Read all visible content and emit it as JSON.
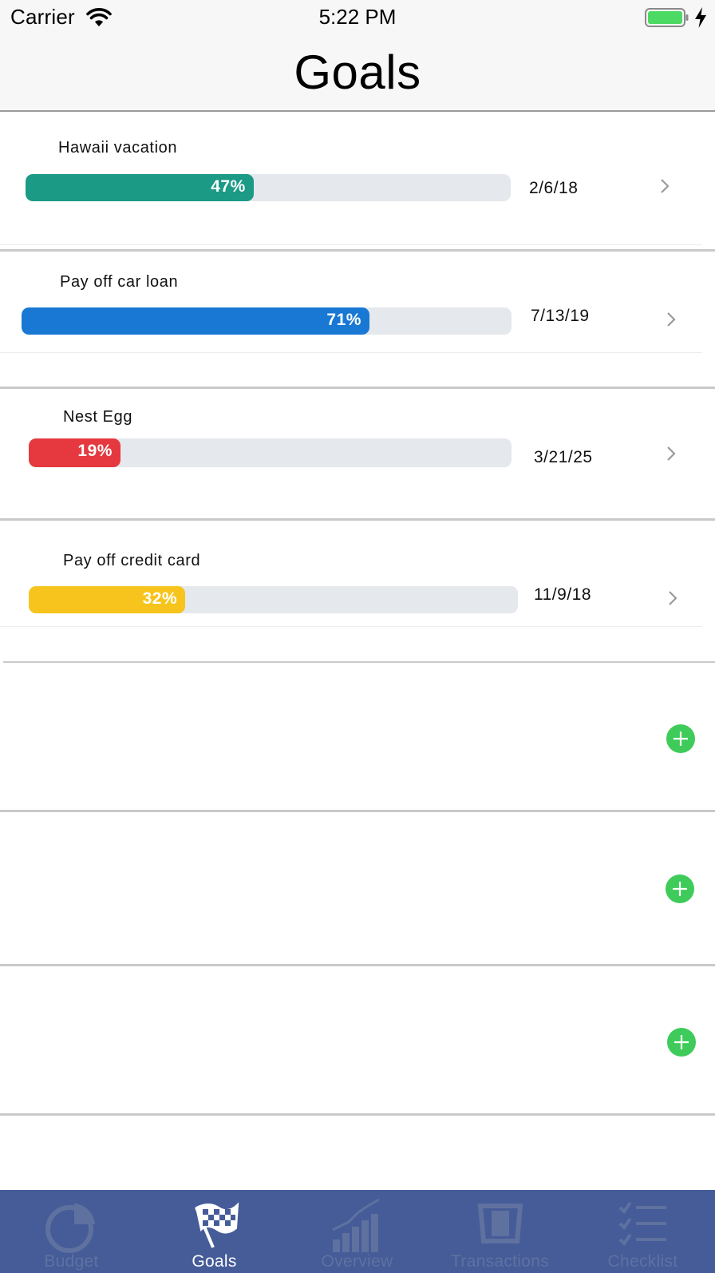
{
  "status_bar": {
    "carrier": "Carrier",
    "time": "5:22 PM",
    "battery_color": "#4cd964"
  },
  "nav": {
    "title": "Goals"
  },
  "goals": [
    {
      "name": "Hawaii vacation",
      "progress": 47,
      "progress_label": "47%",
      "date": "2/6/18",
      "color": "#1b9a85"
    },
    {
      "name": "Pay off car loan",
      "progress": 71,
      "progress_label": "71%",
      "date": "7/13/19",
      "color": "#1878d4"
    },
    {
      "name": "Nest Egg",
      "progress": 19,
      "progress_label": "19%",
      "date": "3/21/25",
      "color": "#e5393f"
    },
    {
      "name": "Pay off credit card",
      "progress": 32,
      "progress_label": "32%",
      "date": "11/9/18",
      "color": "#f6c41c"
    }
  ],
  "add_button_color": "#3ecb5a",
  "tabs": [
    {
      "label": "Budget",
      "icon": "pie-chart-icon",
      "active": false
    },
    {
      "label": "Goals",
      "icon": "checkered-flag-icon",
      "active": true
    },
    {
      "label": "Overview",
      "icon": "bar-chart-icon",
      "active": false
    },
    {
      "label": "Transactions",
      "icon": "receipt-icon",
      "active": false
    },
    {
      "label": "Checklist",
      "icon": "checklist-icon",
      "active": false
    }
  ],
  "tab_bar_color": "#455c99"
}
